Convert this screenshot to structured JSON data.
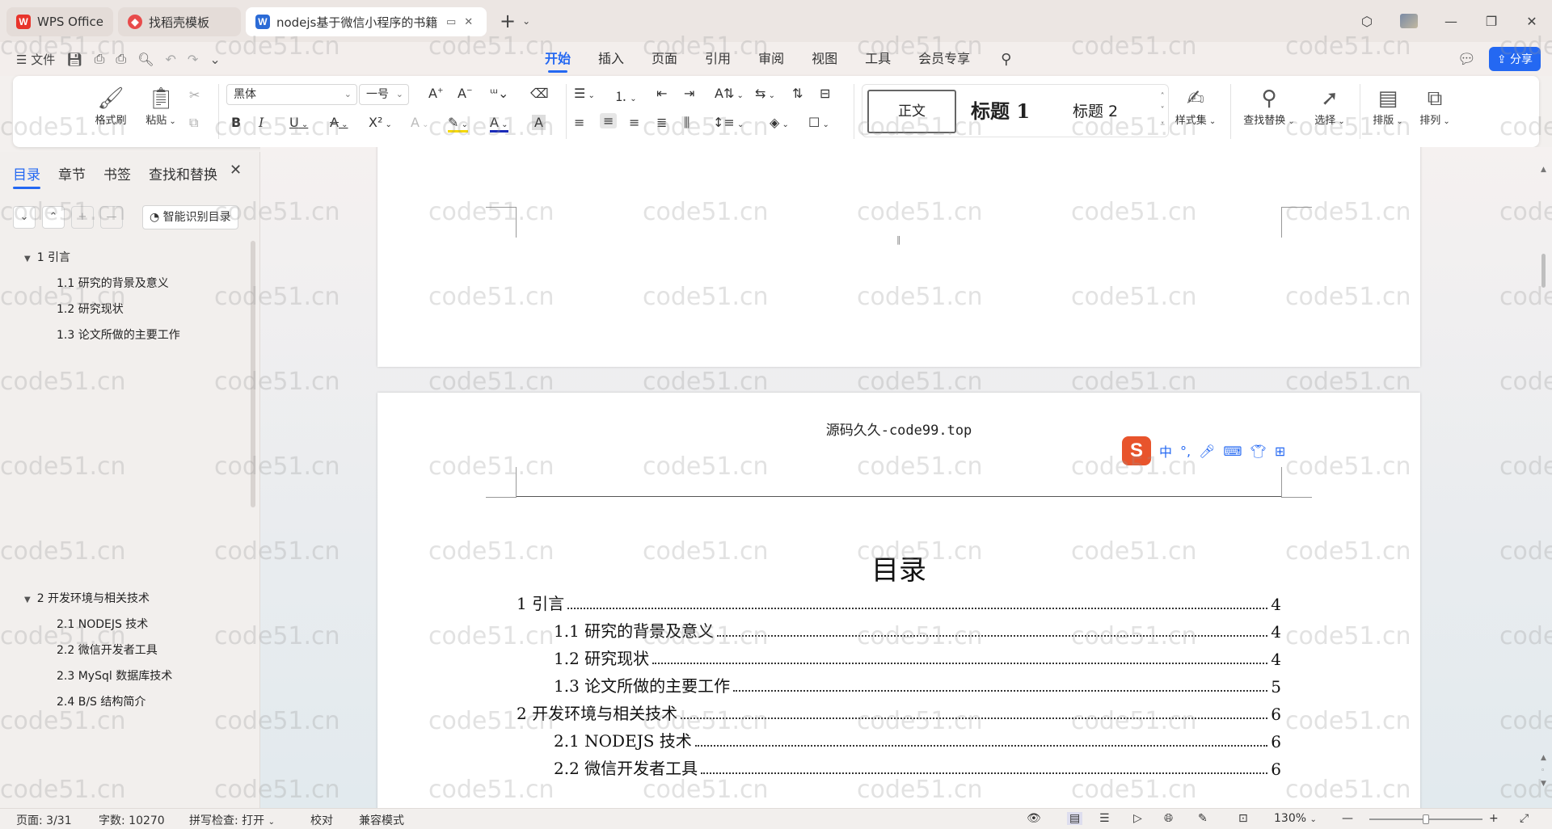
{
  "titlebar": {
    "tabs": [
      {
        "label": "WPS Office",
        "icon": "wps-logo-icon",
        "color": "#e8342b"
      },
      {
        "label": "找稻壳模板",
        "icon": "docer-logo-icon",
        "color": "#e84b4b"
      },
      {
        "label": "nodejs基于微信小程序的书籍",
        "icon": "word-doc-icon",
        "color": "#2b6bd6"
      }
    ],
    "new_tab": "+"
  },
  "menubar": {
    "file_label": "文件",
    "tabs": [
      "开始",
      "插入",
      "页面",
      "引用",
      "审阅",
      "视图",
      "工具",
      "会员专享"
    ],
    "active_tab": "开始",
    "share_label": "分享"
  },
  "ribbon": {
    "format_painter": "格式刷",
    "paste": "粘贴",
    "font_name": "黑体",
    "font_size": "一号",
    "style_normal": "正文",
    "style_h1": "标题 1",
    "style_h2": "标题 2",
    "style_set": "样式集",
    "find_replace": "查找替换",
    "select": "选择",
    "layout": "排版",
    "arrange": "排列"
  },
  "navpane": {
    "tabs": [
      "目录",
      "章节",
      "书签",
      "查找和替换"
    ],
    "active_tab": "目录",
    "smart_toc": "智能识别目录",
    "items": [
      {
        "label": "1  引言",
        "level": 1
      },
      {
        "label": "1.1 研究的背景及意义",
        "level": 2
      },
      {
        "label": "1.2 研究现状",
        "level": 2
      },
      {
        "label": "1.3 论文所做的主要工作",
        "level": 2
      },
      {
        "label": "2  开发环境与相关技术",
        "level": 1
      },
      {
        "label": "2.1 NODEJS 技术",
        "level": 2
      },
      {
        "label": "2.2 微信开发者工具",
        "level": 2
      },
      {
        "label": "2.3 MySql 数据库技术",
        "level": 2
      },
      {
        "label": "2.4 B/S 结构简介",
        "level": 2
      }
    ]
  },
  "document": {
    "page_header": "源码久久-code99.top",
    "toc_title": "目录",
    "toc_lines": [
      {
        "label": "1  引言",
        "page": "4",
        "level": 1
      },
      {
        "label": "1.1 研究的背景及意义",
        "page": "4",
        "level": 2
      },
      {
        "label": "1.2 研究现状",
        "page": "4",
        "level": 2
      },
      {
        "label": "1.3 论文所做的主要工作",
        "page": "5",
        "level": 2
      },
      {
        "label": "2  开发环境与相关技术",
        "page": "6",
        "level": 1
      },
      {
        "label": "2.1 NODEJS 技术",
        "page": "6",
        "level": 2
      },
      {
        "label": "2.2 微信开发者工具",
        "page": "6",
        "level": 2
      }
    ],
    "watermark": "code51.cn"
  },
  "ime": {
    "mode": "中",
    "punct": "°,"
  },
  "statusbar": {
    "page": "页面: 3/31",
    "words": "字数: 10270",
    "spell": "拼写检查: 打开",
    "proof": "校对",
    "compat": "兼容模式",
    "zoom": "130%"
  }
}
